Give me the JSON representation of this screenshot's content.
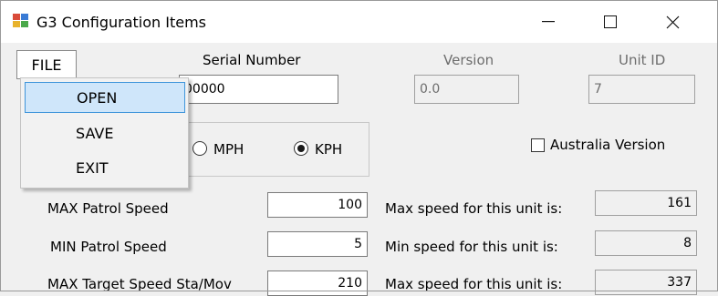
{
  "window": {
    "title": "G3 Configuration Items",
    "minimize_glyph": "—",
    "maximize_glyph": "☐",
    "close_glyph": "✕",
    "icon": "app-icon"
  },
  "menu": {
    "file_label": "FILE",
    "items": [
      {
        "label": "OPEN",
        "highlighted": true
      },
      {
        "label": "SAVE"
      },
      {
        "label": "EXIT"
      }
    ]
  },
  "header": {
    "serial_label": "Serial Number",
    "serial_value": "00000",
    "version_label": "Version",
    "version_value": "0.0",
    "unit_id_label": "Unit ID",
    "unit_id_value": "7"
  },
  "units": {
    "mph_label": "MPH",
    "kph_label": "KPH",
    "selected": "KPH",
    "australia_label": "Australia Version",
    "australia_checked": false
  },
  "settings": [
    {
      "label": "MAX Patrol Speed",
      "value": "100",
      "info_label": "Max speed for this unit is:",
      "info_value": "161"
    },
    {
      "label": "MIN Patrol Speed",
      "value": "5",
      "info_label": "Min speed for this unit is:",
      "info_value": "8"
    },
    {
      "label": "MAX Target Speed Sta/Mov",
      "value": "210",
      "info_label": "Max speed for this unit is:",
      "info_value": "337"
    }
  ],
  "colors": {
    "highlight_bg": "#cfe6fa",
    "highlight_border": "#3f95da",
    "window_bg": "#f0f0f0"
  }
}
